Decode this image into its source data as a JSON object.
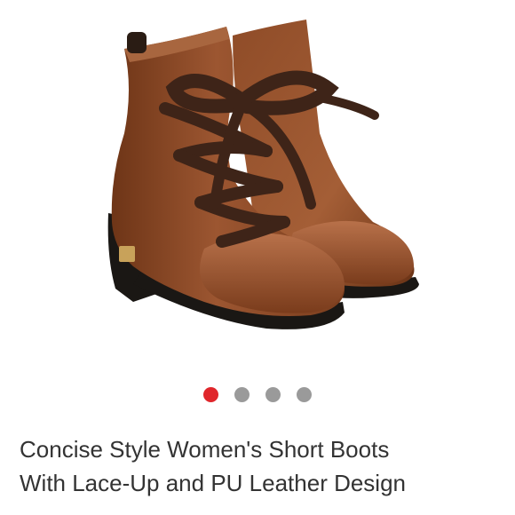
{
  "product": {
    "image_icon": "boots-product-photo",
    "title_line1": "Concise Style Women's Short Boots",
    "title_line2": "With Lace-Up and PU Leather Design"
  },
  "pager": {
    "total": 4,
    "active_index": 0,
    "active_color": "#e0262b",
    "inactive_color": "#9a9a9a"
  },
  "colors": {
    "leather": "#8a4a28",
    "lace": "#3e2418",
    "sole": "#1a1714"
  }
}
